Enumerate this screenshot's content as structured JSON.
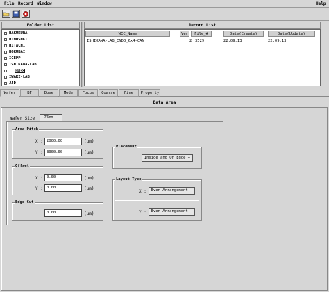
{
  "menu": {
    "file": "File",
    "record": "Record",
    "window": "Window",
    "help": "Help"
  },
  "toolbar": {
    "icons": [
      "folder-icon",
      "save-icon",
      "record-icon"
    ]
  },
  "folder_panel": {
    "title": "Folder List",
    "items": [
      "HAKUKURA",
      "HINOSHKI",
      "HITACHI",
      "HOKUBAI",
      "ICEPP",
      "ISHIKAWA-LAB",
      "ENDO",
      "IWAKI-LAB",
      "JJD"
    ]
  },
  "record_panel": {
    "title": "Record List",
    "columns": [
      "WEC_Name",
      "Ver",
      "File_#",
      "Date(Create)",
      "Date(Update)"
    ],
    "rows": [
      [
        "ISHIKAWA-LAB_ENDO_6x4-CAN",
        "2",
        "3529",
        "22.09.13",
        "22.09.13"
      ]
    ]
  },
  "tabs": [
    "Wafer",
    "BF",
    "Dose",
    "Mode",
    "Focus",
    "Coarse",
    "Fine",
    "Property"
  ],
  "data_area": {
    "title": "Data Area",
    "wafer_size_label": "Wafer Size",
    "wafer_size_value": "76mm",
    "area_pitch": {
      "title": "Area Pitch",
      "x_label": "X :",
      "x_value": "2000.00",
      "y_label": "Y :",
      "y_value": "3000.00",
      "unit": "(um)"
    },
    "offset": {
      "title": "Offset",
      "x_label": "X :",
      "x_value": "0.00",
      "y_label": "Y :",
      "y_value": "0.00",
      "unit": "(um)"
    },
    "edge_cut": {
      "title": "Edge Cut",
      "value": "0.00",
      "unit": "(um)"
    },
    "placement": {
      "title": "Placement",
      "value": "Inside and On Edge"
    },
    "layout_type": {
      "title": "Layout Type",
      "x_label": "X :",
      "x_value": "Even Arrangement",
      "y_label": "Y :",
      "y_value": "Even Arrangement"
    }
  }
}
